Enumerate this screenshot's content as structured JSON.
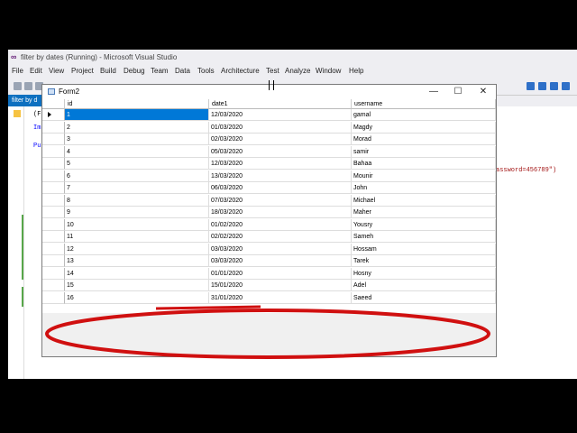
{
  "vs": {
    "title": "filter by dates (Running) - Microsoft Visual Studio",
    "menu": [
      "File",
      "Edit",
      "View",
      "Project",
      "Build",
      "Debug",
      "Team",
      "Data",
      "Tools",
      "Architecture",
      "Test",
      "Analyze",
      "Window",
      "Help"
    ],
    "tab_label": "filter by d",
    "code": {
      "line1": "(F",
      "line2": "Im",
      "line3": "Pu",
      "password_fragment": "assword=456789\")"
    }
  },
  "form": {
    "caption": "Form2",
    "minimize": "—",
    "maximize": "☐",
    "close": "✕"
  },
  "grid": {
    "columns": [
      "id",
      "date1",
      "username"
    ],
    "rows": [
      [
        "1",
        "12/03/2020",
        "gamal"
      ],
      [
        "2",
        "01/03/2020",
        "Magdy"
      ],
      [
        "3",
        "02/03/2020",
        "Morad"
      ],
      [
        "4",
        "05/03/2020",
        "samir"
      ],
      [
        "5",
        "12/03/2020",
        "Bahaa"
      ],
      [
        "6",
        "13/03/2020",
        "Mounir"
      ],
      [
        "7",
        "06/03/2020",
        "John"
      ],
      [
        "8",
        "07/03/2020",
        "Michael"
      ],
      [
        "9",
        "18/03/2020",
        "Maher"
      ],
      [
        "10",
        "01/02/2020",
        "Yousry"
      ],
      [
        "11",
        "02/02/2020",
        "Sameh"
      ],
      [
        "12",
        "03/03/2020",
        "Hossam"
      ],
      [
        "13",
        "03/03/2020",
        "Tarek"
      ],
      [
        "14",
        "01/01/2020",
        "Hosny"
      ],
      [
        "15",
        "15/01/2020",
        "Adel"
      ],
      [
        "16",
        "31/01/2020",
        "Saeed"
      ]
    ]
  },
  "colors": {
    "accent": "#0078d7",
    "annotation": "#d01010",
    "vs_purple": "#68217a"
  }
}
